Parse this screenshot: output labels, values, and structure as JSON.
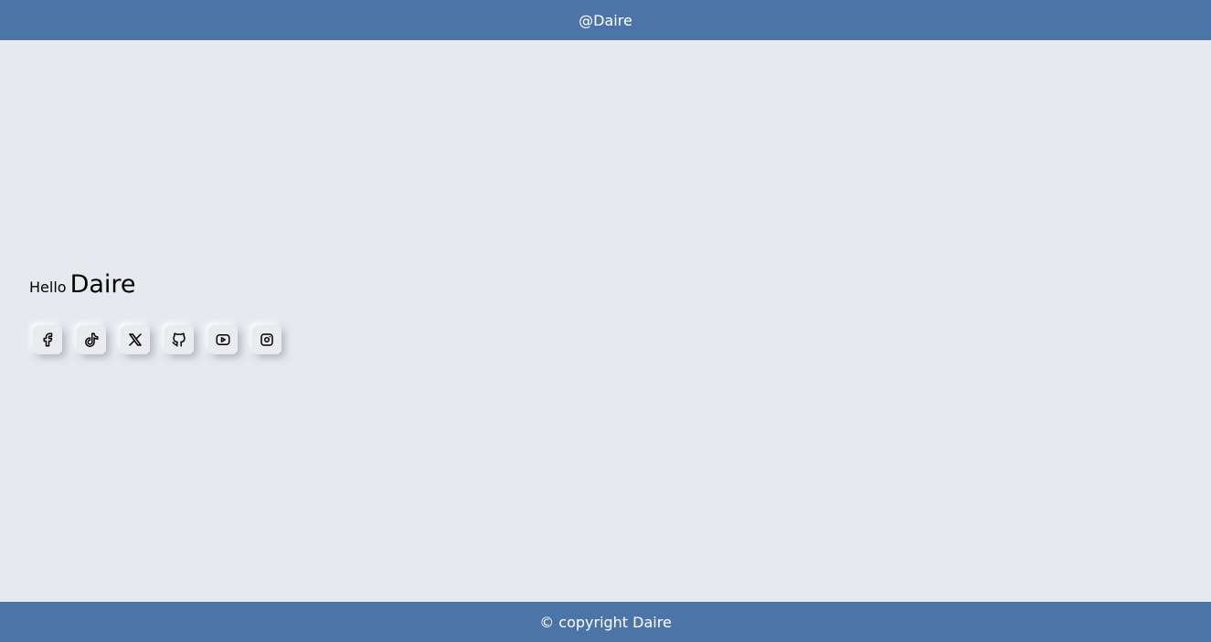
{
  "header": {
    "handle": "@Daire"
  },
  "hero": {
    "greeting": "Hello",
    "name": "Daire"
  },
  "socials": [
    {
      "icon": "facebook-icon",
      "label": "Facebook"
    },
    {
      "icon": "tiktok-icon",
      "label": "TikTok"
    },
    {
      "icon": "x-icon",
      "label": "X"
    },
    {
      "icon": "github-icon",
      "label": "GitHub"
    },
    {
      "icon": "youtube-icon",
      "label": "YouTube"
    },
    {
      "icon": "instagram-icon",
      "label": "Instagram"
    }
  ],
  "footer": {
    "copyright": "© copyright Daire"
  },
  "colors": {
    "bar": "#4c74a7",
    "background": "#e6e9ee",
    "text": "#000000",
    "bar_text": "#ffffff"
  }
}
